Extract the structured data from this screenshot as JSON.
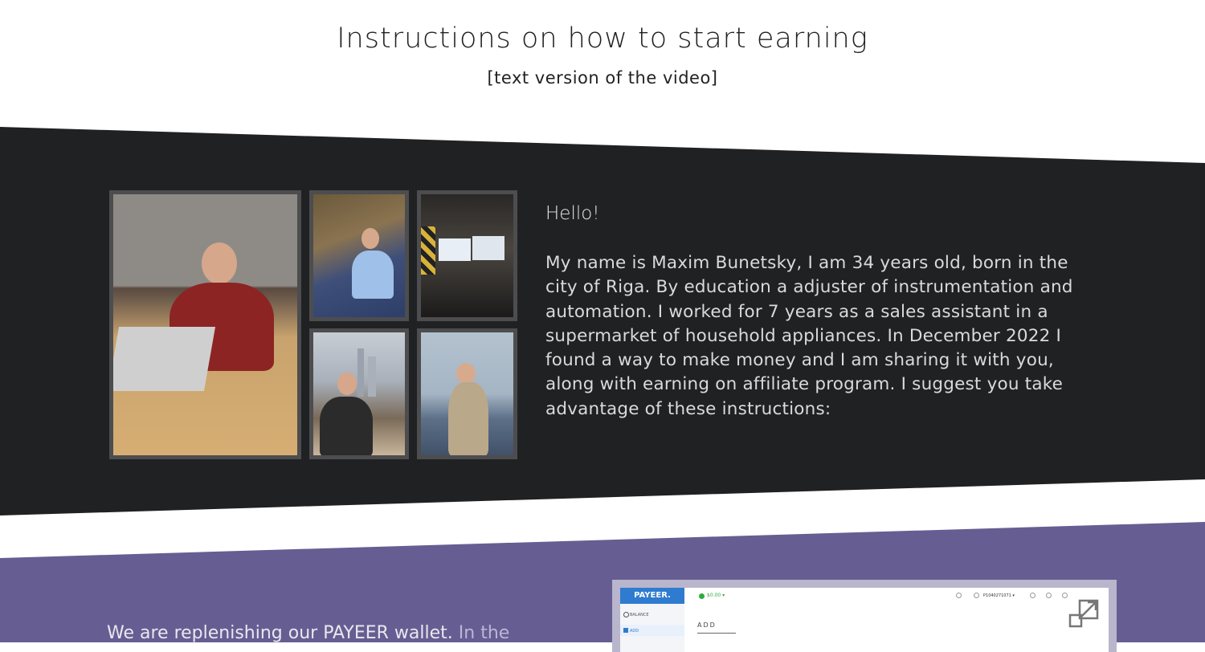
{
  "header": {
    "title": "Instructions on how to start earning",
    "subtitle": "[text version of the video]"
  },
  "intro": {
    "greeting": "Hello!",
    "bio": "My name is Maxim Bunetsky, I am 34 years old, born in the city of Riga. By education a adjuster of instrumentation and automation. I worked for 7 years as a sales assistant in a supermarket of household appliances. In December 2022 I found a way to make money and I am sharing it with you, along with earning on affiliate program. I suggest you take advantage of these instructions:"
  },
  "step": {
    "text_main": "We are replenishing our PAYEER wallet.",
    "text_muted": "In the"
  },
  "payeer_screenshot": {
    "logo": "PAYEER.",
    "balance": "$0.00 ▾",
    "nav_balance": "BALANCE",
    "nav_add": "ADD",
    "heading": "ADD",
    "account": "P1040271071 ▾"
  },
  "colors": {
    "dark_band": "#202123",
    "purple_band": "#665e92",
    "photo_border": "#4d4d4f"
  }
}
